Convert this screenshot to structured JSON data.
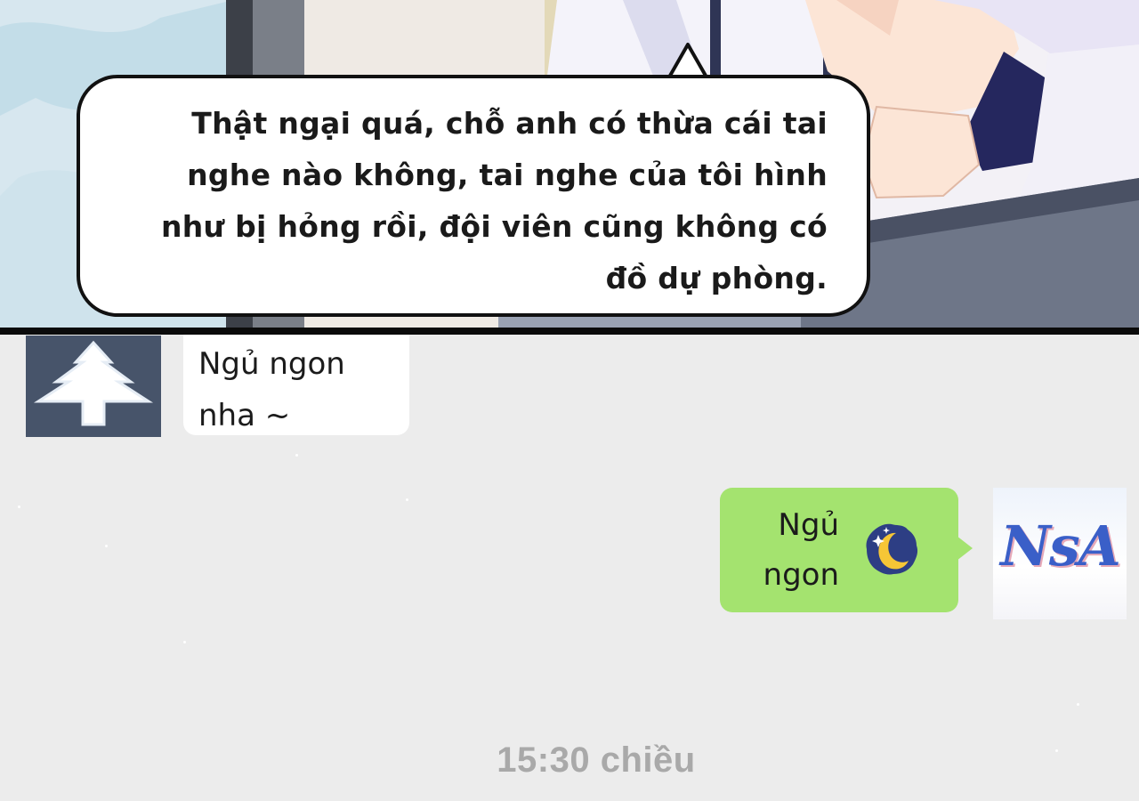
{
  "comic_panel": {
    "speech_bubble": {
      "lines": [
        "Thật ngại quá, chỗ anh có thừa cái tai",
        "nghe nào không, tai nghe của tôi hình",
        "như bị hỏng rồi, đội viên cũng không có",
        "đồ dự phòng."
      ]
    }
  },
  "chat": {
    "incoming_message": {
      "lines": [
        "Ngủ ngon",
        "nha ~"
      ],
      "avatar_icon": "tree-icon"
    },
    "outgoing_message": {
      "lines": [
        "Ngủ",
        "ngon"
      ],
      "emoji_icon": "crescent-moon-icon",
      "bubble_color": "#a4e36f",
      "avatar_text": "NsA"
    },
    "timestamp": "15:30 chiều"
  },
  "colors": {
    "chat_background": "#ececec",
    "incoming_bubble": "#ffffff",
    "outgoing_bubble": "#a4e36f",
    "timestamp_text": "#a9a9a9"
  }
}
